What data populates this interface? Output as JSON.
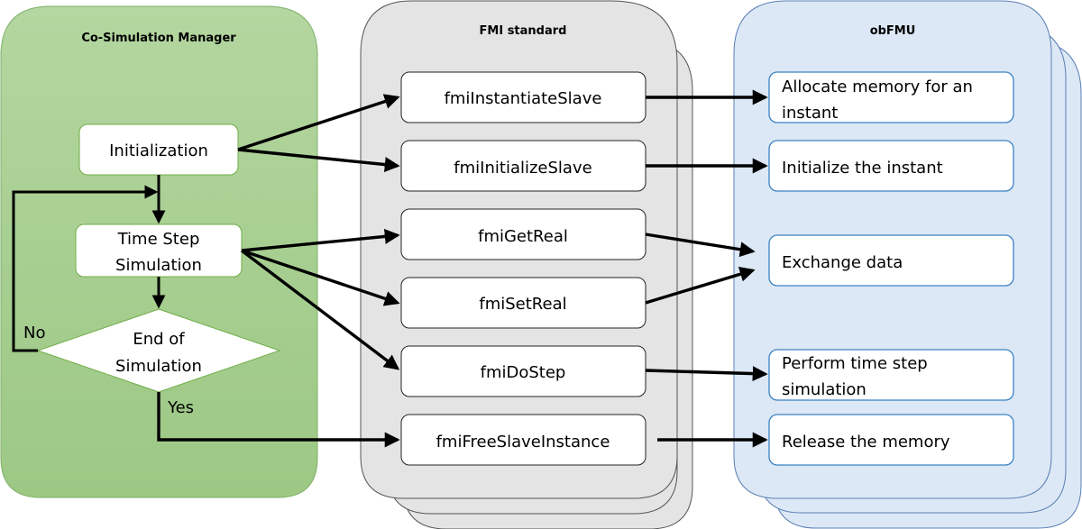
{
  "panels": {
    "manager": {
      "title": "Co-Simulation Manager",
      "fill": "#a9d08e",
      "stroke": "#70ad47"
    },
    "fmi": {
      "title": "FMI standard",
      "fill": "#e4e4e4",
      "stroke": "#555555"
    },
    "obfmu": {
      "title": "obFMU",
      "fill": "#dce8f5",
      "stroke": "#5b7fb5"
    }
  },
  "manager_nodes": {
    "initialization": "Initialization",
    "time_step_line1": "Time Step",
    "time_step_line2": "Simulation",
    "decision_line1": "End of",
    "decision_line2": "Simulation",
    "no_label": "No",
    "yes_label": "Yes"
  },
  "fmi_functions": [
    "fmiInstantiateSlave",
    "fmiInitializeSlave",
    "fmiGetReal",
    "fmiSetReal",
    "fmiDoStep",
    "fmiFreeSlaveInstance"
  ],
  "obfmu_actions": {
    "allocate_line1": "Allocate memory for an",
    "allocate_line2": "instant",
    "initialize": "Initialize the instant",
    "exchange": "Exchange data",
    "perform_line1": "Perform time step",
    "perform_line2": "simulation",
    "release": "Release the memory"
  }
}
